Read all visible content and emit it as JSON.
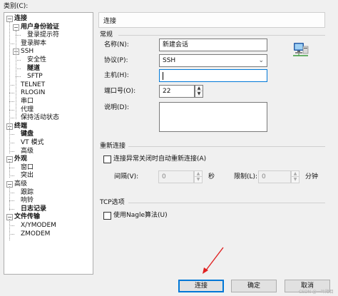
{
  "category_label": "类别(C):",
  "tree": [
    {
      "label": "连接",
      "bold": true,
      "expander": "−"
    },
    {
      "label": "用户身份验证",
      "bold": true,
      "expander": "−"
    },
    {
      "label": "登录提示符",
      "bold": false,
      "expander": ""
    },
    {
      "label": "登录脚本",
      "bold": false,
      "expander": ""
    },
    {
      "label": "SSH",
      "bold": false,
      "expander": "−"
    },
    {
      "label": "安全性",
      "bold": false,
      "expander": ""
    },
    {
      "label": "隧道",
      "bold": true,
      "expander": ""
    },
    {
      "label": "SFTP",
      "bold": false,
      "expander": ""
    },
    {
      "label": "TELNET",
      "bold": false,
      "expander": ""
    },
    {
      "label": "RLOGIN",
      "bold": false,
      "expander": ""
    },
    {
      "label": "串口",
      "bold": false,
      "expander": ""
    },
    {
      "label": "代理",
      "bold": false,
      "expander": ""
    },
    {
      "label": "保持活动状态",
      "bold": false,
      "expander": ""
    },
    {
      "label": "终端",
      "bold": true,
      "expander": "−"
    },
    {
      "label": "键盘",
      "bold": true,
      "expander": ""
    },
    {
      "label": "VT 模式",
      "bold": false,
      "expander": ""
    },
    {
      "label": "高级",
      "bold": false,
      "expander": ""
    },
    {
      "label": "外观",
      "bold": true,
      "expander": "−"
    },
    {
      "label": "窗口",
      "bold": false,
      "expander": ""
    },
    {
      "label": "突出",
      "bold": false,
      "expander": ""
    },
    {
      "label": "高级",
      "bold": false,
      "expander": "−"
    },
    {
      "label": "跟踪",
      "bold": false,
      "expander": ""
    },
    {
      "label": "响铃",
      "bold": false,
      "expander": ""
    },
    {
      "label": "日志记录",
      "bold": true,
      "expander": ""
    },
    {
      "label": "文件传输",
      "bold": true,
      "expander": "−"
    },
    {
      "label": "X/YMODEM",
      "bold": false,
      "expander": ""
    },
    {
      "label": "ZMODEM",
      "bold": false,
      "expander": ""
    }
  ],
  "panel_title": "连接",
  "general": {
    "section_label": "常规",
    "name_label": "名称(N):",
    "name_value": "新建会话",
    "protocol_label": "协议(P):",
    "protocol_value": "SSH",
    "host_label": "主机(H):",
    "host_value": "",
    "port_label": "端口号(O):",
    "port_value": "22",
    "desc_label": "说明(D):",
    "desc_value": ""
  },
  "reconnect": {
    "section_label": "重新连接",
    "auto_label": "连接异常关闭时自动重新连接(A)",
    "auto_checked": false,
    "interval_label": "间隔(V):",
    "interval_value": "0",
    "interval_unit": "秒",
    "limit_label": "限制(L):",
    "limit_value": "0",
    "limit_unit": "分钟"
  },
  "tcp": {
    "section_label": "TCP选项",
    "nagle_label": "使用Nagle算法(U)",
    "nagle_checked": false
  },
  "buttons": {
    "connect": "连接",
    "ok": "确定",
    "cancel": "取消"
  },
  "watermark": "CSDN @一叶障目"
}
